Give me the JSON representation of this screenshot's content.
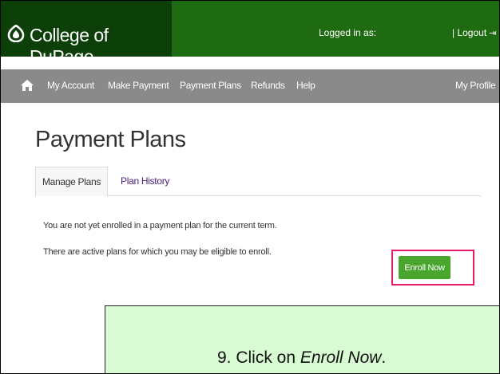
{
  "header": {
    "brand": "College of DuPage",
    "logged_in_label": "Logged in as:",
    "logout_label": "| Logout"
  },
  "nav": {
    "home_icon": "home-icon",
    "items": [
      "My Account",
      "Make Payment",
      "Payment Plans",
      "Refunds",
      "Help"
    ],
    "profile": "My Profile"
  },
  "page": {
    "title": "Payment Plans",
    "tabs": [
      "Manage Plans",
      "Plan History"
    ],
    "message_1": "You are not yet enrolled in a payment plan for the current term.",
    "message_2": "There are active plans for which you may be eligible to enroll.",
    "enroll_button": "Enroll Now"
  },
  "callout": {
    "prefix": "9. Click on ",
    "emphasis": "Enroll Now",
    "suffix": "."
  },
  "colors": {
    "header_green": "#1f6b12",
    "logo_green": "#0d3f09",
    "nav_gray": "#8a8a8a",
    "button_green": "#4aa52e",
    "highlight_pink": "#e6196b",
    "callout_bg": "#d8fbd3"
  }
}
